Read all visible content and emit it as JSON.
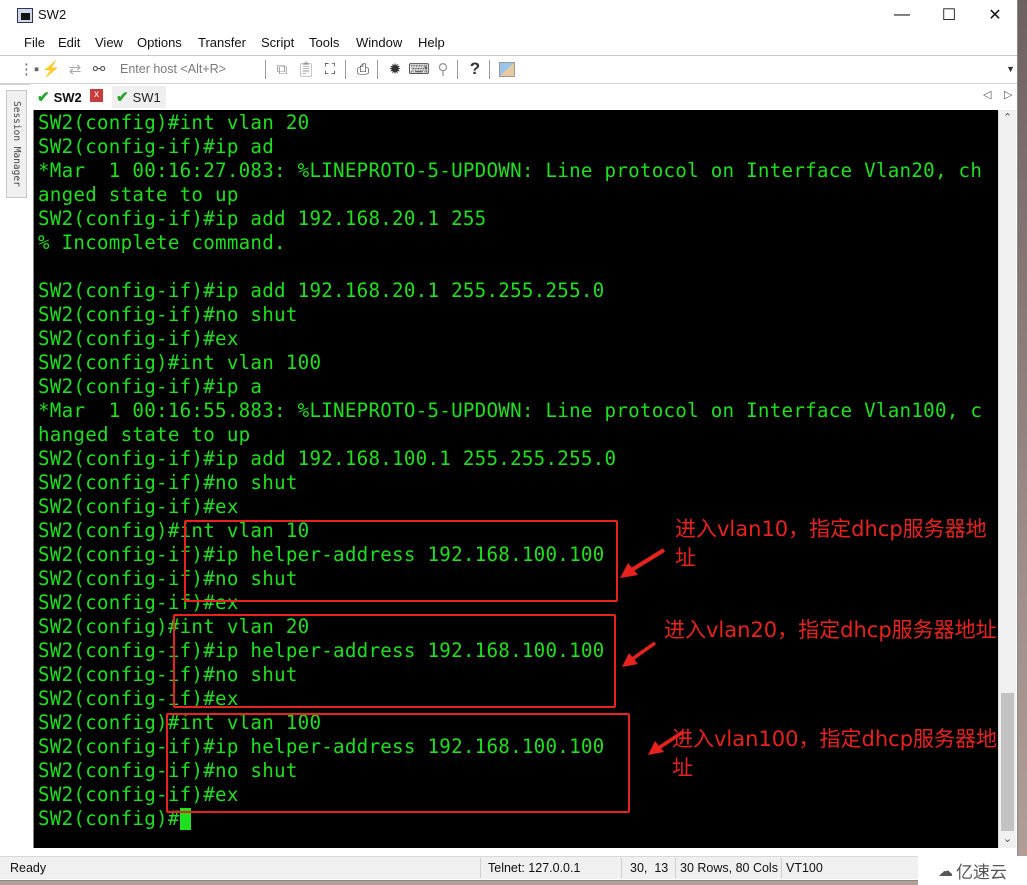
{
  "window": {
    "title": "SW2",
    "controls": {
      "minimize": "—",
      "maximize": "☐",
      "close": "✕"
    }
  },
  "menu": [
    "File",
    "Edit",
    "View",
    "Options",
    "Transfer",
    "Script",
    "Tools",
    "Window",
    "Help"
  ],
  "toolbar": {
    "host_placeholder": "Enter host <Alt+R>",
    "icons": [
      "connect-bar-icon",
      "quick-connect-icon",
      "reconnect-icon",
      "disconnect-icon",
      "copy-icon",
      "paste-icon",
      "find-icon",
      "print-icon",
      "settings-icon",
      "keymap-icon",
      "key-agent-icon",
      "help-icon",
      "secure-file-icon"
    ]
  },
  "sidebar": {
    "label": "Session Manager"
  },
  "tabs": [
    {
      "label": "SW2",
      "active": true,
      "connected": true
    },
    {
      "label": "SW1",
      "active": false,
      "connected": true
    }
  ],
  "terminal": {
    "lines": [
      "SW2(config)#int vlan 20",
      "SW2(config-if)#ip ad",
      "*Mar  1 00:16:27.083: %LINEPROTO-5-UPDOWN: Line protocol on Interface Vlan20, ch",
      "anged state to up",
      "SW2(config-if)#ip add 192.168.20.1 255",
      "% Incomplete command.",
      "",
      "SW2(config-if)#ip add 192.168.20.1 255.255.255.0",
      "SW2(config-if)#no shut",
      "SW2(config-if)#ex",
      "SW2(config)#int vlan 100",
      "SW2(config-if)#ip a",
      "*Mar  1 00:16:55.883: %LINEPROTO-5-UPDOWN: Line protocol on Interface Vlan100, c",
      "hanged state to up",
      "SW2(config-if)#ip add 192.168.100.1 255.255.255.0",
      "SW2(config-if)#no shut",
      "SW2(config-if)#ex",
      "SW2(config)#int vlan 10",
      "SW2(config-if)#ip helper-address 192.168.100.100",
      "SW2(config-if)#no shut",
      "SW2(config-if)#ex",
      "SW2(config)#int vlan 20",
      "SW2(config-if)#ip helper-address 192.168.100.100",
      "SW2(config-if)#no shut",
      "SW2(config-if)#ex",
      "SW2(config)#int vlan 100",
      "SW2(config-if)#ip helper-address 192.168.100.100",
      "SW2(config-if)#no shut",
      "SW2(config-if)#ex",
      "SW2(config)#"
    ],
    "text_color": "#1fe01f",
    "background": "#000000"
  },
  "annotations": [
    {
      "text": "进入vlan10，指定dhcp服务器地址"
    },
    {
      "text": "进入vlan20，指定dhcp服务器地址"
    },
    {
      "text": "进入vlan100，指定dhcp服务器地址"
    }
  ],
  "annotation_color": "#e8231e",
  "scrollbar": {
    "position_fraction": 1.0
  },
  "status": {
    "state": "Ready",
    "connection": "Telnet: 127.0.0.1",
    "cursor": "30,  13",
    "size": "30 Rows, 80 Cols",
    "emulation": "VT100"
  },
  "watermark": "亿速云"
}
